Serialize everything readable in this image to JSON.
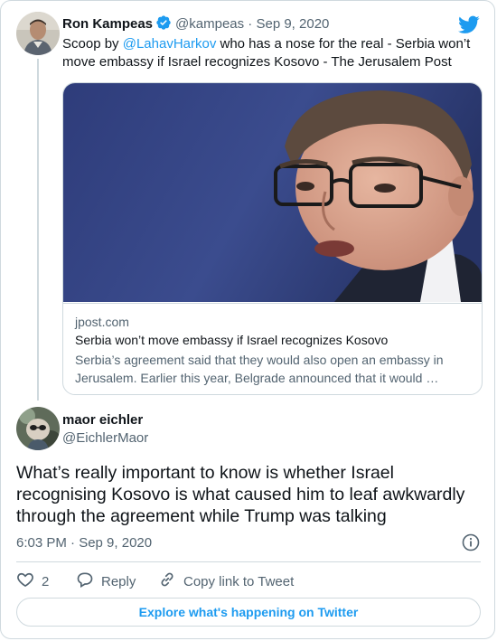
{
  "quoted_tweet": {
    "author_name": "Ron Kampeas",
    "handle": "@kampeas",
    "separator": "·",
    "date": "Sep 9, 2020",
    "text_prefix": "Scoop by ",
    "mention": "@LahavHarkov",
    "text_suffix": " who has a nose for the real - Serbia won’t move embassy if Israel recognizes Kosovo - The Jerusalem Post",
    "link_card": {
      "domain": "jpost.com",
      "title": "Serbia won’t move embassy if Israel recognizes Kosovo",
      "description_line1": "Serbia’s agreement said that they would also open an embassy in",
      "description_line2": "Jerusalem. Earlier this year, Belgrade announced that it would …"
    }
  },
  "main_tweet": {
    "author_name": "maor eichler",
    "handle": "@EichlerMaor",
    "text_lines": [
      "What’s really important to know is whether Israel",
      "recognising Kosovo is what caused him to leaf awkwardly",
      "through the agreement while Trump was talking"
    ],
    "timestamp": "6:03 PM · Sep 9, 2020",
    "likes": "2",
    "reply_label": "Reply",
    "copy_link_label": "Copy link to Tweet"
  },
  "footer": {
    "explore_label": "Explore what's happening on Twitter"
  },
  "colors": {
    "accent": "#1d9bf0",
    "text": "#0f1419",
    "muted": "#536471",
    "border": "#cfd9de"
  },
  "icons": [
    "twitter-bird-icon",
    "verified-badge-icon",
    "info-icon",
    "heart-icon",
    "reply-icon",
    "link-icon"
  ]
}
